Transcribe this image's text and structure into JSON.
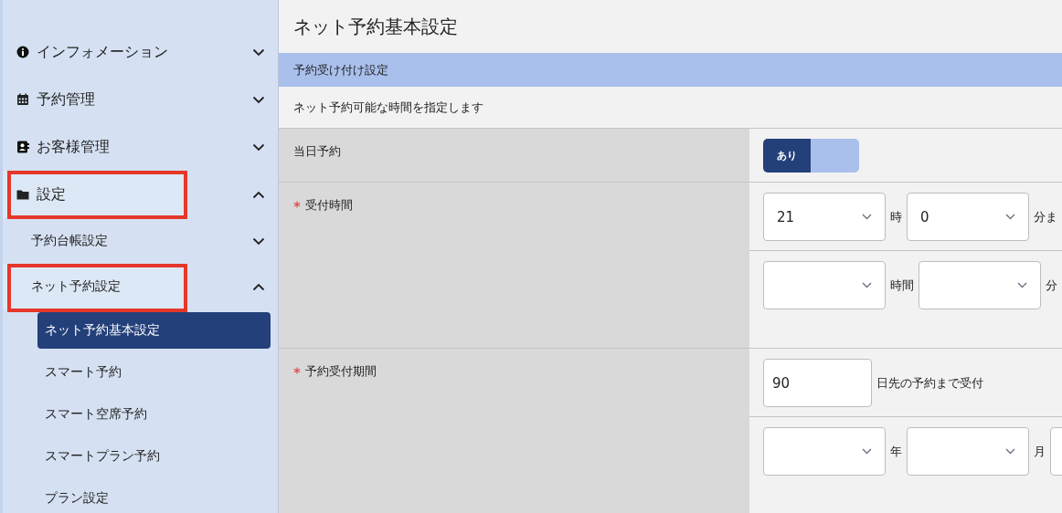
{
  "sidebar": {
    "items": [
      {
        "label": "インフォメーション",
        "expanded": false,
        "highlighted": false
      },
      {
        "label": "予約管理",
        "expanded": false,
        "highlighted": false
      },
      {
        "label": "お客様管理",
        "expanded": false,
        "highlighted": false
      },
      {
        "label": "設定",
        "expanded": true,
        "highlighted": true,
        "children": [
          {
            "label": "予約台帳設定",
            "expanded": false,
            "highlighted": false
          },
          {
            "label": "ネット予約設定",
            "expanded": true,
            "highlighted": true,
            "children": [
              {
                "label": "ネット予約基本設定",
                "selected": true
              },
              {
                "label": "スマート予約",
                "selected": false
              },
              {
                "label": "スマート空席予約",
                "selected": false
              },
              {
                "label": "スマートプラン予約",
                "selected": false
              },
              {
                "label": "プラン設定",
                "selected": false
              }
            ]
          }
        ]
      }
    ]
  },
  "page": {
    "title": "ネット予約基本設定",
    "section": {
      "heading": "予約受け付け設定",
      "description": "ネット予約可能な時間を指定します"
    },
    "rows": [
      {
        "label": "当日予約",
        "required": false,
        "lines": [
          [
            {
              "kind": "toggle",
              "label": "あり",
              "on": true
            }
          ]
        ]
      },
      {
        "label": "受付時間",
        "required": true,
        "lines": [
          [
            {
              "kind": "select",
              "value": "21"
            },
            {
              "kind": "text",
              "text": "時"
            },
            {
              "kind": "select",
              "value": "0"
            },
            {
              "kind": "text",
              "text": "分ま"
            }
          ],
          [
            {
              "kind": "select"
            },
            {
              "kind": "text",
              "text": "時間"
            },
            {
              "kind": "select"
            },
            {
              "kind": "text",
              "text": "分"
            }
          ]
        ]
      },
      {
        "label": "予約受付期間",
        "required": true,
        "lines": [
          [
            {
              "kind": "input",
              "value": "90"
            },
            {
              "kind": "text",
              "text": "日先の予約まで受付"
            }
          ],
          [
            {
              "kind": "select"
            },
            {
              "kind": "text",
              "text": "年"
            },
            {
              "kind": "select"
            },
            {
              "kind": "text",
              "text": "月"
            },
            {
              "kind": "select"
            }
          ]
        ]
      }
    ]
  }
}
